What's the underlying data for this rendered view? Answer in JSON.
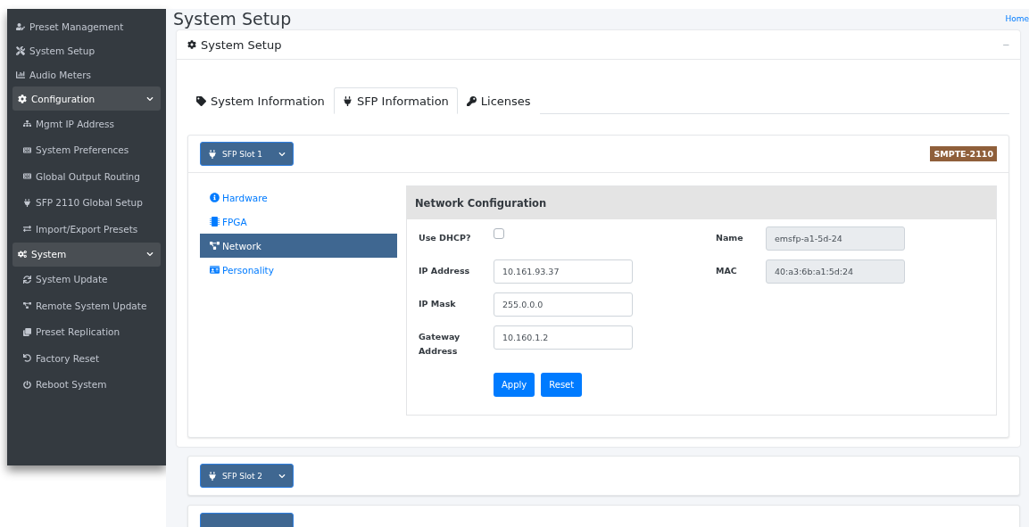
{
  "sidebar": {
    "items": [
      {
        "label": "Preset Management"
      },
      {
        "label": "System Setup"
      },
      {
        "label": "Audio Meters"
      },
      {
        "label": "Configuration",
        "expanded": true,
        "children": [
          {
            "label": "Mgmt IP Address"
          },
          {
            "label": "System Preferences"
          },
          {
            "label": "Global Output Routing"
          },
          {
            "label": "SFP 2110 Global Setup"
          },
          {
            "label": "Import/Export Presets"
          }
        ]
      },
      {
        "label": "System",
        "expanded": true,
        "children": [
          {
            "label": "System Update"
          },
          {
            "label": "Remote System Update"
          },
          {
            "label": "Preset Replication"
          },
          {
            "label": "Factory Reset"
          },
          {
            "label": "Reboot System"
          }
        ]
      }
    ]
  },
  "header": {
    "title": "System Setup",
    "breadcrumb": "Home"
  },
  "card": {
    "title": "System Setup",
    "collapse": "−"
  },
  "tabs": [
    {
      "label": "System Information",
      "selected": false
    },
    {
      "label": "SFP Information",
      "selected": true
    },
    {
      "label": "Licenses",
      "selected": false
    }
  ],
  "slots": [
    {
      "label": "SFP Slot 1",
      "expanded": true,
      "badge": "SMPTE-2110"
    },
    {
      "label": "SFP Slot 2",
      "expanded": false
    },
    {
      "expanded": false
    }
  ],
  "slot_nav": [
    {
      "label": "Hardware",
      "selected": false
    },
    {
      "label": "FPGA",
      "selected": false
    },
    {
      "label": "Network",
      "selected": true
    },
    {
      "label": "Personality",
      "selected": false
    }
  ],
  "network": {
    "title": "Network Configuration",
    "left_fields": [
      {
        "kind": "checkbox",
        "label": "Use DHCP?",
        "checked": false
      },
      {
        "kind": "input",
        "label": "IP Address",
        "value": "10.161.93.37"
      },
      {
        "kind": "input",
        "label": "IP Mask",
        "value": "255.0.0.0"
      },
      {
        "kind": "input",
        "label": "Gateway Address",
        "value": "10.160.1.2"
      }
    ],
    "right_fields": [
      {
        "kind": "readonly",
        "label": "Name",
        "value": "emsfp-a1-5d-24"
      },
      {
        "kind": "readonly",
        "label": "MAC",
        "value": "40:a3:6b:a1:5d:24"
      }
    ],
    "buttons": [
      "Apply",
      "Reset"
    ]
  }
}
